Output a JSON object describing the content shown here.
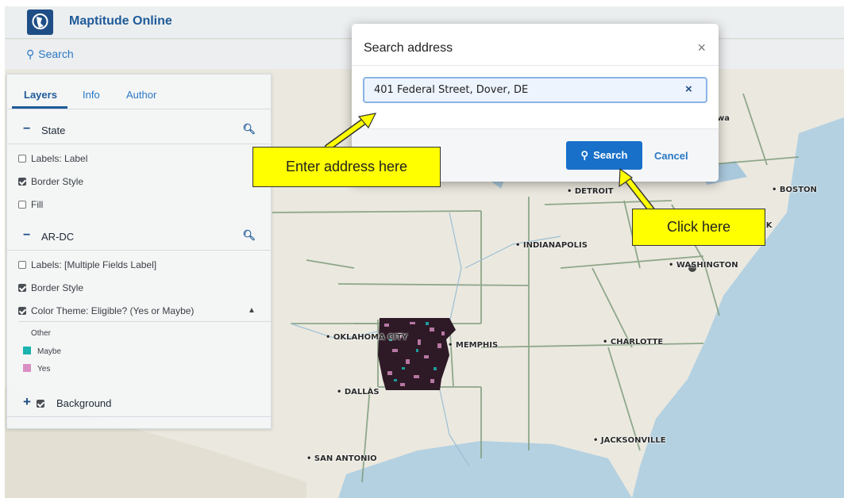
{
  "app": {
    "title": "Maptitude Online",
    "logo_icon": "globe-logo-icon",
    "search_link": "Search"
  },
  "panel": {
    "tabs": [
      {
        "label": "Layers",
        "active": true
      },
      {
        "label": "Info",
        "active": false
      },
      {
        "label": "Author",
        "active": false
      }
    ],
    "groups": [
      {
        "name": "State",
        "toggle": "−",
        "rows": [
          {
            "label": "Labels: Label",
            "checked": false
          },
          {
            "label": "Border Style",
            "checked": true
          },
          {
            "label": "Fill",
            "checked": false
          }
        ]
      },
      {
        "name": "AR-DC",
        "toggle": "−",
        "rows": [
          {
            "label": "Labels: [Multiple Fields Label]",
            "checked": false
          },
          {
            "label": "Border Style",
            "checked": true
          },
          {
            "label": "Color Theme: Eligible? (Yes or Maybe)",
            "checked": true
          }
        ],
        "legend": [
          {
            "label": "Other",
            "color": "transparent"
          },
          {
            "label": "Maybe",
            "color": "#1ab3b0"
          },
          {
            "label": "Yes",
            "color": "#d98fc1"
          }
        ]
      },
      {
        "name": "Background",
        "toggle": "+",
        "checked": true
      }
    ]
  },
  "map": {
    "cities": [
      "• DETROIT",
      "• BOSTON",
      "• INDIANAPOLIS",
      "• WASHINGTON",
      "• OKLAHOMA CITY",
      "• MEMPHIS",
      "• CHARLOTTE",
      "• DALLAS",
      "• JACKSONVILLE",
      "• SAN ANTONIO"
    ],
    "partial_labels": [
      "wa",
      "RK"
    ]
  },
  "modal": {
    "title": "Search address",
    "close_icon": "×",
    "address_value": "401 Federal Street, Dover, DE",
    "clear_icon": "×",
    "search_button": "Search",
    "cancel_button": "Cancel"
  },
  "callouts": {
    "address": "Enter address here",
    "click": "Click here"
  },
  "colors": {
    "accent": "#1870c8",
    "brand": "#1f5a99",
    "callout": "#ffff00"
  }
}
